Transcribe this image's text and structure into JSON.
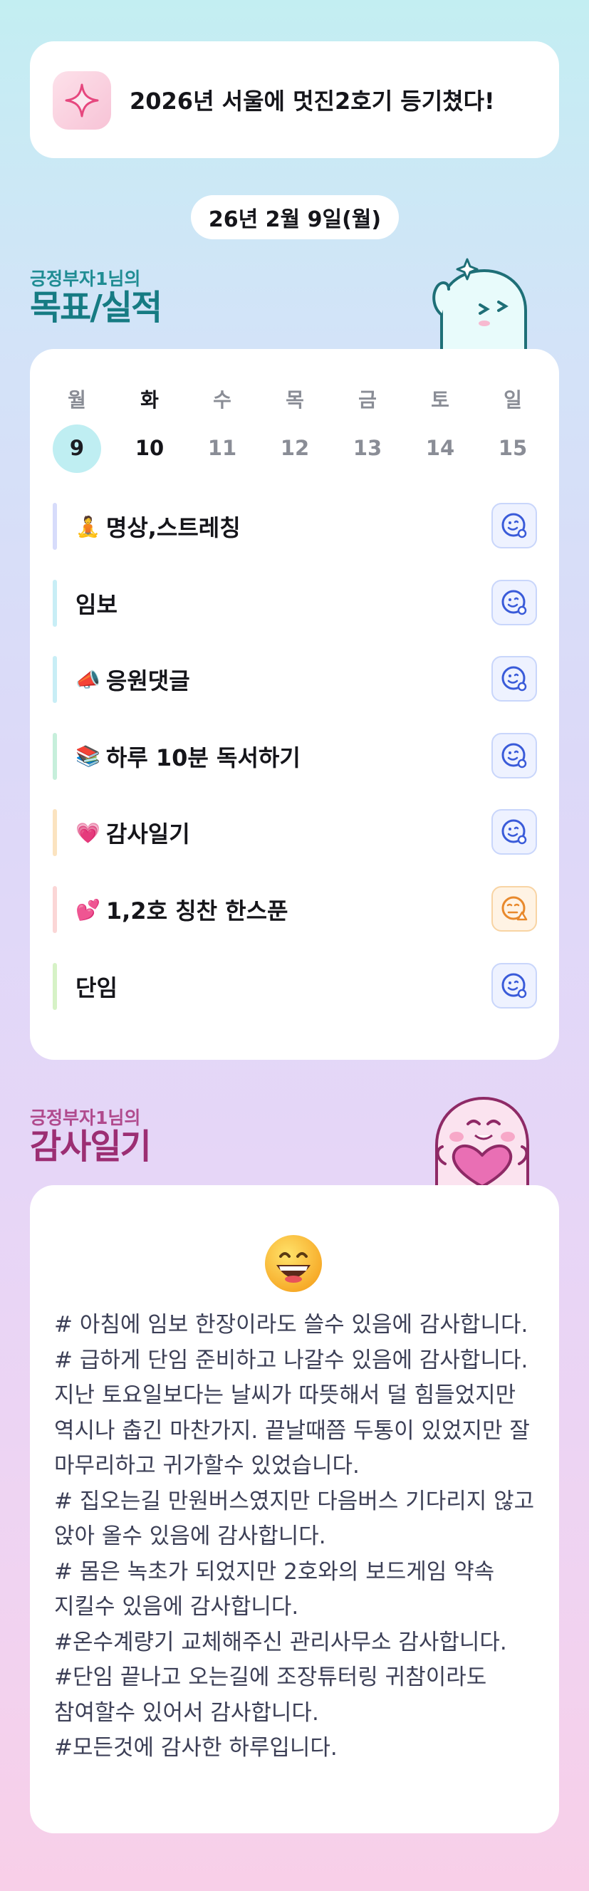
{
  "goal_banner": {
    "icon": "sparkle-icon",
    "text": "2026년 서울에 멋진2호기 등기쳤다!"
  },
  "date_pill": "26년 2월 9일(월)",
  "goals_section": {
    "subtitle": "긍정부자1님의",
    "title": "목표/실적"
  },
  "week": {
    "days": [
      "월",
      "화",
      "수",
      "목",
      "금",
      "토",
      "일"
    ],
    "dates": [
      "9",
      "10",
      "11",
      "12",
      "13",
      "14",
      "15"
    ],
    "selected_index": 0,
    "today_index": 1
  },
  "tasks": [
    {
      "emoji": "🧘",
      "label": "명상,스트레칭",
      "status": "done-face",
      "bar_color": "#d7dcfb"
    },
    {
      "emoji": "",
      "label": "임보",
      "status": "done-face",
      "bar_color": "#c8eef6"
    },
    {
      "emoji": "📣",
      "label": "응원댓글",
      "status": "done-face",
      "bar_color": "#c8eef6"
    },
    {
      "emoji": "📚",
      "label": "하루 10분 독서하기",
      "status": "done-face",
      "bar_color": "#c6efdb"
    },
    {
      "emoji": "💗",
      "label": "감사일기",
      "status": "done-face",
      "bar_color": "#fbe3c0"
    },
    {
      "emoji": "💕",
      "label": "1,2호 칭찬 한스푼",
      "status": "warning-face",
      "bar_color": "#fbd6d6"
    },
    {
      "emoji": "",
      "label": "단임",
      "status": "done-face",
      "bar_color": "#d6f2c6"
    }
  ],
  "thanks_section": {
    "subtitle": "긍정부자1님의",
    "title": "감사일기"
  },
  "thanks_card": {
    "emoji": "grinning-face-icon",
    "text": "# 아침에 임보 한장이라도 쓸수 있음에 감사합니다.\n# 급하게 단임 준비하고 나갈수 있음에 감사합니다. 지난 토요일보다는 날씨가 따뜻해서 덜 힘들었지만 역시나 춥긴 마찬가지. 끝날때쯤 두통이 있었지만 잘 마무리하고 귀가할수 있었습니다.\n# 집오는길 만원버스였지만 다음버스 기다리지 않고 앉아 올수 있음에 감사합니다.\n# 몸은 녹초가 되었지만 2호와의 보드게임 약속 지킬수 있음에 감사합니다.\n#온수계량기 교체해주신 관리사무소 감사합니다.\n#단임 끝나고 오는길에 조장튜터링 귀참이라도 참여할수 있어서 감사합니다.\n#모든것에 감사한 하루입니다."
  },
  "colors": {
    "accent_teal": "#167b83",
    "accent_pink": "#9c2e73",
    "face_blue": "#3a5bd9",
    "face_orange": "#e8892c"
  }
}
